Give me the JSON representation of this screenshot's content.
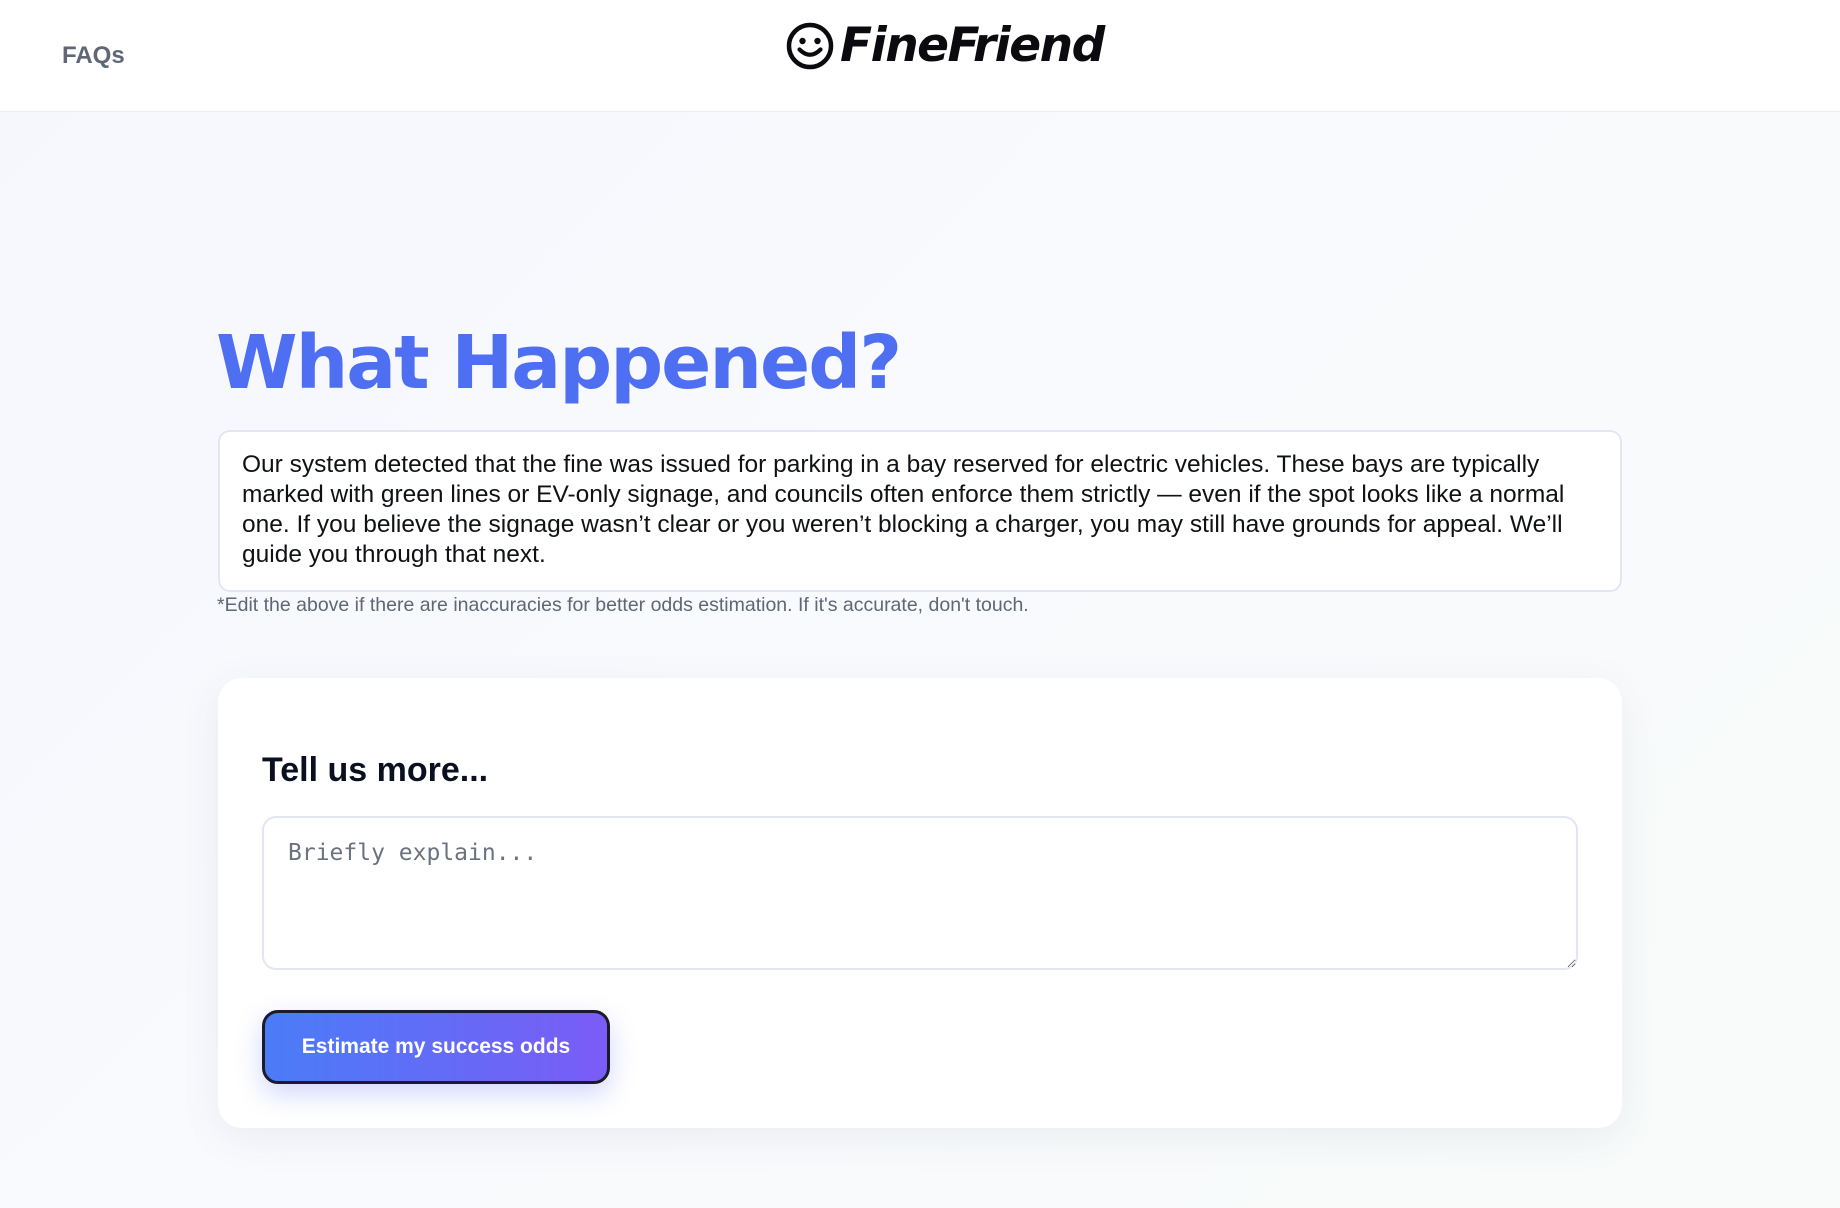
{
  "header": {
    "faqs_label": "FAQs",
    "brand_name": "FineFriend",
    "logo_icon": "smiley-face-icon"
  },
  "main": {
    "title": "What Happened?",
    "summary_text": "Our system detected that the fine was issued for parking in a bay reserved for electric vehicles. These bays are typically marked with green lines or EV-only signage, and councils often enforce them strictly — even if the spot looks like a normal one. If you believe the signage wasn’t clear or you weren’t blocking a charger, you may still have grounds for appeal. We’ll guide you through that next.",
    "edit_note": "*Edit the above if there are inaccuracies for better odds estimation. If it's accurate, don't touch."
  },
  "card": {
    "title": "Tell us more...",
    "explain_placeholder": "Briefly explain...",
    "explain_value": "",
    "submit_label": "Estimate my success odds"
  },
  "colors": {
    "accent_title": "#4e6ff2",
    "button_gradient_start": "#4a7cf7",
    "button_gradient_end": "#7b5cf6",
    "muted_text": "#5f6675"
  }
}
